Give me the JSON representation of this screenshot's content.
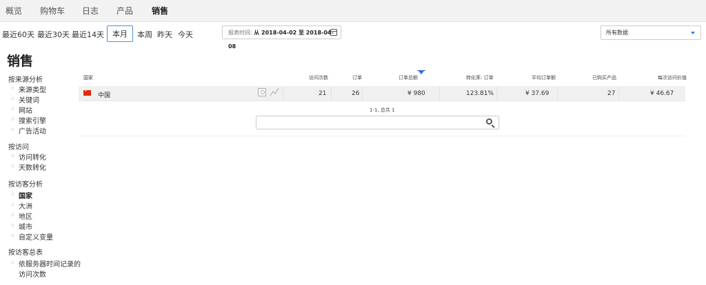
{
  "topnav": {
    "tabs": [
      {
        "label": "概览"
      },
      {
        "label": "购物车"
      },
      {
        "label": "日志"
      },
      {
        "label": "产品"
      },
      {
        "label": "销售"
      }
    ],
    "active_tab": "销售"
  },
  "periods": [
    {
      "label": "最近60天"
    },
    {
      "label": "最近30天"
    },
    {
      "label": "最近14天"
    },
    {
      "label": "本月"
    },
    {
      "label": "本周"
    },
    {
      "label": "昨天"
    },
    {
      "label": "今天"
    }
  ],
  "selected_period": "本月",
  "date_range": {
    "label": "报表时间:",
    "value": "从 2018-04-02 至 2018-04-08"
  },
  "segment": {
    "value": "所有数据"
  },
  "page_title": "销售",
  "sidebar": {
    "groups": [
      {
        "title": "按来源分析",
        "items": [
          "来源类型",
          "关键词",
          "网站",
          "搜索引擎",
          "广告活动"
        ]
      },
      {
        "title": "按访问",
        "items": [
          "访问转化",
          "天数转化"
        ]
      },
      {
        "title": "按访客分析",
        "items": [
          "国家",
          "大洲",
          "地区",
          "城市",
          "自定义变量"
        ]
      },
      {
        "title": "按访客总表",
        "items": [
          "依服务器时间记录的",
          "访问次数"
        ]
      }
    ],
    "active_item": "国家"
  },
  "table": {
    "columns": [
      "国家",
      "访问次数",
      "订单",
      "订单总额",
      "转化率: 订单",
      "平均订单额",
      "已购买产品",
      "每次访问价值"
    ],
    "sorted_column": "订单总额",
    "rows": [
      {
        "country": "中国",
        "visits": "21",
        "orders": "26",
        "revenue": "¥ 980",
        "conversion": "123.81%",
        "avg_order": "¥ 37.69",
        "products": "27",
        "value_per_visit": "¥ 46.67"
      }
    ]
  },
  "pagination": {
    "text": "1-1, 总共 1"
  },
  "search": {
    "placeholder": ""
  }
}
